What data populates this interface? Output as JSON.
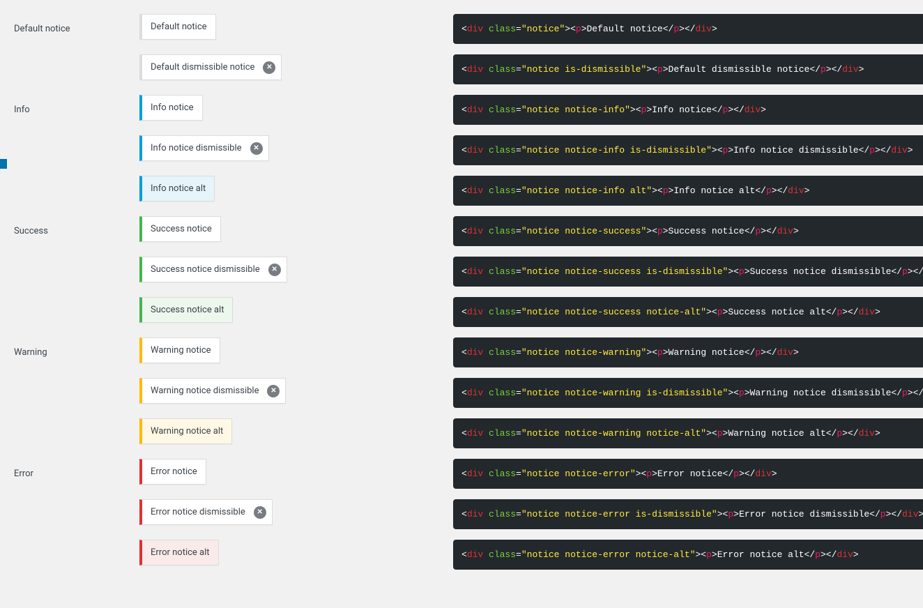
{
  "sections": [
    {
      "label": "Default notice",
      "items": [
        {
          "text": "Default notice",
          "cls": "notice-default",
          "dismissible": false,
          "alt": false,
          "code_class": "notice"
        },
        {
          "text": "Default dismissible notice",
          "cls": "notice-default",
          "dismissible": true,
          "alt": false,
          "code_class": "notice is-dismissible"
        }
      ]
    },
    {
      "label": "Info",
      "items": [
        {
          "text": "Info notice",
          "cls": "notice-info",
          "dismissible": false,
          "alt": false,
          "code_class": "notice notice-info"
        },
        {
          "text": "Info notice dismissible",
          "cls": "notice-info",
          "dismissible": true,
          "alt": false,
          "code_class": "notice notice-info is-dismissible"
        },
        {
          "text": "Info notice alt",
          "cls": "notice-info",
          "dismissible": false,
          "alt": true,
          "code_class": "notice notice-info alt"
        }
      ]
    },
    {
      "label": "Success",
      "items": [
        {
          "text": "Success notice",
          "cls": "notice-success",
          "dismissible": false,
          "alt": false,
          "code_class": "notice notice-success"
        },
        {
          "text": "Success notice dismissible",
          "cls": "notice-success",
          "dismissible": true,
          "alt": false,
          "code_class": "notice notice-success is-dismissible"
        },
        {
          "text": "Success notice alt",
          "cls": "notice-success",
          "dismissible": false,
          "alt": true,
          "code_class": "notice notice-success notice-alt"
        }
      ]
    },
    {
      "label": "Warning",
      "items": [
        {
          "text": "Warning notice",
          "cls": "notice-warning",
          "dismissible": false,
          "alt": false,
          "code_class": "notice notice-warning"
        },
        {
          "text": "Warning notice dismissible",
          "cls": "notice-warning",
          "dismissible": true,
          "alt": false,
          "code_class": "notice notice-warning is-dismissible"
        },
        {
          "text": "Warning notice alt",
          "cls": "notice-warning",
          "dismissible": false,
          "alt": true,
          "code_class": "notice notice-warning notice-alt"
        }
      ]
    },
    {
      "label": "Error",
      "items": [
        {
          "text": "Error notice",
          "cls": "notice-error",
          "dismissible": false,
          "alt": false,
          "code_class": "notice notice-error"
        },
        {
          "text": "Error notice dismissible",
          "cls": "notice-error",
          "dismissible": true,
          "alt": false,
          "code_class": "notice notice-error is-dismissible"
        },
        {
          "text": "Error notice alt",
          "cls": "notice-error",
          "dismissible": false,
          "alt": true,
          "code_class": "notice notice-error notice-alt"
        }
      ]
    }
  ]
}
